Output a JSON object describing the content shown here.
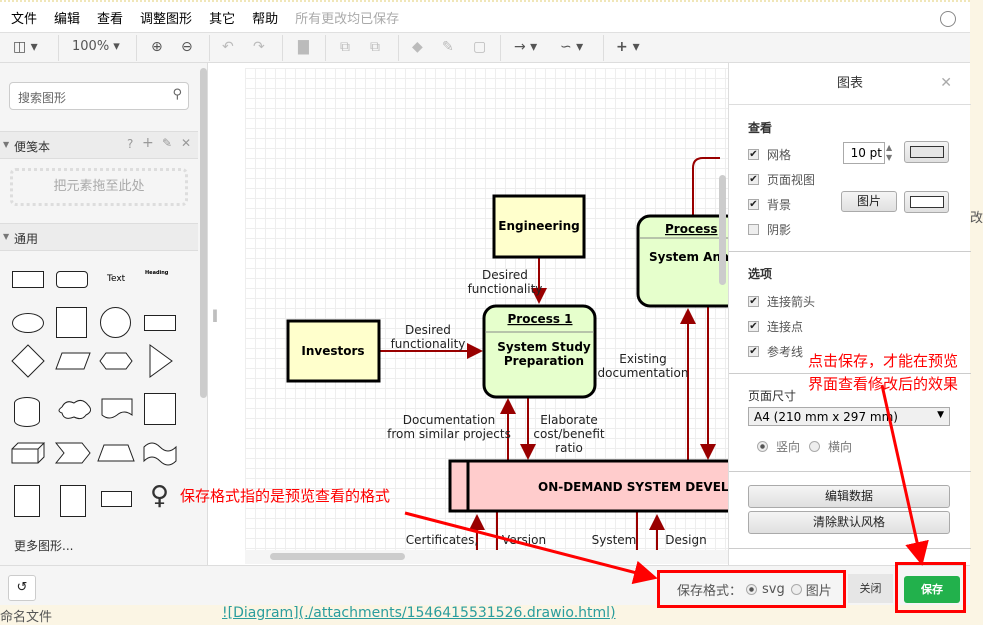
{
  "menu": {
    "items": [
      "文件",
      "编辑",
      "查看",
      "调整图形",
      "其它",
      "帮助"
    ],
    "status": "所有更改均已保存"
  },
  "toolbar": {
    "zoom": "100%"
  },
  "sidebar": {
    "search_placeholder": "搜索图形",
    "scratchpad": "便笺本",
    "scratch_help": "?",
    "drop_hint": "把元素拖至此处",
    "general": "通用",
    "text_shape": "Text",
    "heading_shape": "Heading",
    "more": "更多图形..."
  },
  "diagram": {
    "engineering": "Engineering",
    "investors": "Investors",
    "process1_title": "Process 1",
    "process1_body1": "System Study",
    "process1_body2": "Preparation",
    "process2_title": "Process",
    "process2_body": "System Ana",
    "ondemand": "ON-DEMAND SYSTEM DEVELO",
    "lbl_desired1a": "Desired",
    "lbl_desired1b": "functionality",
    "lbl_desired2a": "Desired",
    "lbl_desired2b": "functionality",
    "lbl_existing_a": "Existing",
    "lbl_existing_b": "documentation",
    "lbl_doc_a": "Documentation",
    "lbl_doc_b": "from similar projects",
    "lbl_elab_a": "Elaborate",
    "lbl_elab_b": "cost/benefit",
    "lbl_elab_c": "ratio",
    "lbl_cert": "Certificates,",
    "lbl_version": "Version",
    "lbl_system": "System",
    "lbl_design": "Design",
    "edge_color": "#990000",
    "entity_fill": "#ffffcc",
    "process_fill": "#e6ffcc",
    "store_fill": "#ffcccc"
  },
  "panel": {
    "title": "图表",
    "view": "查看",
    "grid": "网格",
    "grid_size": "10 pt",
    "page_view": "页面视图",
    "background": "背景",
    "image_btn": "图片",
    "shadow": "阴影",
    "options": "选项",
    "conn_arrows": "连接箭头",
    "conn_points": "连接点",
    "guides": "参考线",
    "page_size": "页面尺寸",
    "page_size_value": "A4 (210 mm x 297 mm)",
    "portrait": "竖向",
    "landscape": "横向",
    "edit_data": "编辑数据",
    "clear_style": "清除默认风格",
    "checks": {
      "grid": true,
      "page_view": true,
      "background": true,
      "shadow": false,
      "conn_arrows": true,
      "conn_points": true,
      "guides": true
    }
  },
  "footer": {
    "format_label": "保存格式：",
    "svg": "svg",
    "image": "图片",
    "close": "关闭",
    "save": "保存",
    "save_color": "#22b14c"
  },
  "annotations": {
    "format_note": "保存格式指的是预览查看的格式",
    "save_note1": "点击保存，才能在预览",
    "save_note2": "界面查看修改后的效果"
  },
  "background_page": {
    "side_text": "改",
    "file_name": "命名文件",
    "link": "![Diagram](./attachments/1546415531526.drawio.html)"
  }
}
